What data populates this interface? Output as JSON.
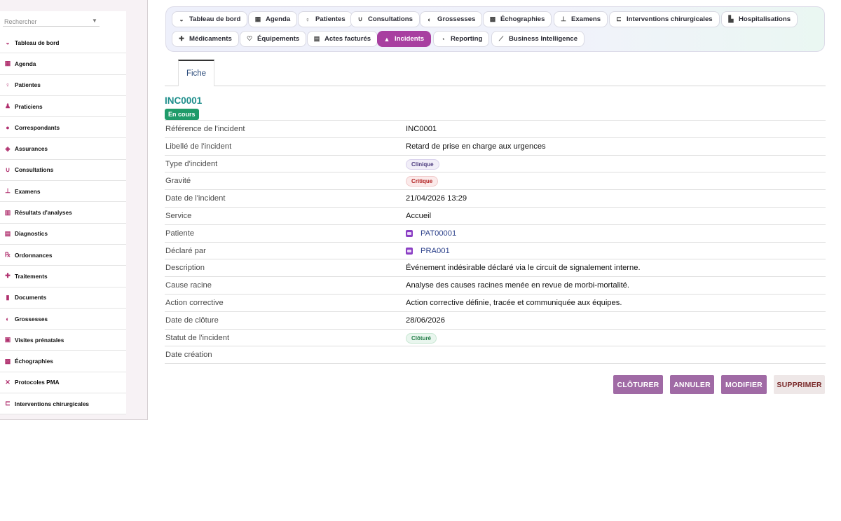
{
  "sidebar": {
    "search_placeholder": "Rechercher",
    "items": [
      {
        "label": "Tableau de bord",
        "icon": "dashboard-icon"
      },
      {
        "label": "Agenda",
        "icon": "calendar-icon"
      },
      {
        "label": "Patientes",
        "icon": "female-icon"
      },
      {
        "label": "Praticiens",
        "icon": "doctor-icon"
      },
      {
        "label": "Correspondants",
        "icon": "user-icon"
      },
      {
        "label": "Assurances",
        "icon": "shield-icon"
      },
      {
        "label": "Consultations",
        "icon": "stethoscope-icon"
      },
      {
        "label": "Examens",
        "icon": "examination-icon"
      },
      {
        "label": "Résultats d'analyses",
        "icon": "lab-results-icon"
      },
      {
        "label": "Diagnostics",
        "icon": "diagnostics-icon"
      },
      {
        "label": "Ordonnances",
        "icon": "prescription-icon"
      },
      {
        "label": "Traitements",
        "icon": "pills-icon"
      },
      {
        "label": "Documents",
        "icon": "document-icon"
      },
      {
        "label": "Grossesses",
        "icon": "pregnancy-icon"
      },
      {
        "label": "Visites prénatales",
        "icon": "prenatal-icon"
      },
      {
        "label": "Échographies",
        "icon": "ultrasound-icon"
      },
      {
        "label": "Protocoles PMA",
        "icon": "dna-icon"
      },
      {
        "label": "Interventions chirurgicales",
        "icon": "surgery-bed-icon"
      }
    ]
  },
  "topnav": {
    "tabs": [
      {
        "label": "Tableau de bord",
        "icon": "dashboard-icon"
      },
      {
        "label": "Agenda",
        "icon": "calendar-icon"
      },
      {
        "label": "Patientes",
        "icon": "female-icon"
      },
      {
        "label": "Consultations",
        "icon": "stethoscope-icon"
      },
      {
        "label": "Grossesses",
        "icon": "pregnancy-icon"
      },
      {
        "label": "Échographies",
        "icon": "ultrasound-icon"
      },
      {
        "label": "Examens",
        "icon": "examination-icon"
      },
      {
        "label": "Interventions chirurgicales",
        "icon": "surgery-bed-icon"
      },
      {
        "label": "Hospitalisations",
        "icon": "hospital-icon"
      },
      {
        "label": "Médicaments",
        "icon": "pills-icon"
      },
      {
        "label": "Équipements",
        "icon": "equipment-icon"
      },
      {
        "label": "Actes facturés",
        "icon": "invoice-icon"
      },
      {
        "label": "Incidents",
        "icon": "warning-icon",
        "active": true
      },
      {
        "label": "Reporting",
        "icon": "pie-chart-icon"
      },
      {
        "label": "Business Intelligence",
        "icon": "line-chart-icon"
      }
    ]
  },
  "detail": {
    "tab_label": "Fiche",
    "title": "INC0001",
    "status": "En cours",
    "status_color": "#1f9b6a",
    "accent_color": "#a83fa0",
    "rows": [
      {
        "label": "Référence de l'incident",
        "value": "INC0001"
      },
      {
        "label": "Libellé de l'incident",
        "value": "Retard de prise en charge aux urgences"
      },
      {
        "label": "Type d'incident",
        "value": "Clinique"
      },
      {
        "label": "Gravité",
        "value": "Critique"
      },
      {
        "label": "Date de l'incident",
        "value": "21/04/2026 13:29"
      },
      {
        "label": "Service",
        "value": "Accueil"
      },
      {
        "label": "Patiente",
        "value": "PAT00001"
      },
      {
        "label": "Déclaré par",
        "value": "PRA001"
      },
      {
        "label": "Description",
        "value": "Événement indésirable déclaré via le circuit de signalement interne."
      },
      {
        "label": "Cause racine",
        "value": "Analyse des causes racines menée en revue de morbi-mortalité."
      },
      {
        "label": "Action corrective",
        "value": "Action corrective définie, tracée et communiquée aux équipes."
      },
      {
        "label": "Date de clôture",
        "value": "28/06/2026"
      },
      {
        "label": "Statut de l'incident",
        "value": "Clôturé"
      },
      {
        "label": "Date création",
        "value": ""
      }
    ]
  },
  "actions": {
    "close_label": "CLÔTURER",
    "cancel_label": "ANNULER",
    "edit_label": "MODIFIER",
    "delete_label": "SUPPRIMER"
  }
}
